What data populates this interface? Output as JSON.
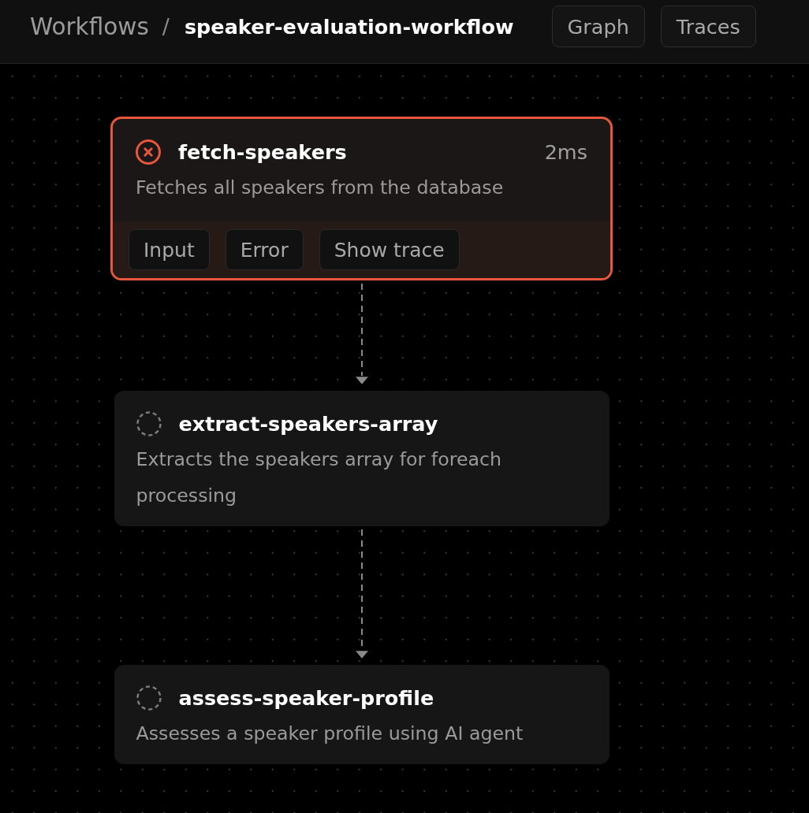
{
  "header": {
    "breadcrumb": {
      "parent": "Workflows",
      "separator": "/",
      "current": "speaker-evaluation-workflow"
    },
    "view_buttons": [
      {
        "label": "Graph"
      },
      {
        "label": "Traces"
      }
    ]
  },
  "steps": [
    {
      "name": "fetch-speakers",
      "kind": "failed",
      "duration": "2ms",
      "description": "Fetches all speakers from the database",
      "actions": [
        {
          "label": "Input"
        },
        {
          "label": "Error"
        },
        {
          "label": "Show trace"
        }
      ]
    },
    {
      "name": "extract-speakers-array",
      "kind": "pending",
      "description": "Extracts the speakers array for foreach processing"
    },
    {
      "name": "assess-speaker-profile",
      "kind": "pending",
      "description": "Assesses a speaker profile using AI agent"
    }
  ]
}
